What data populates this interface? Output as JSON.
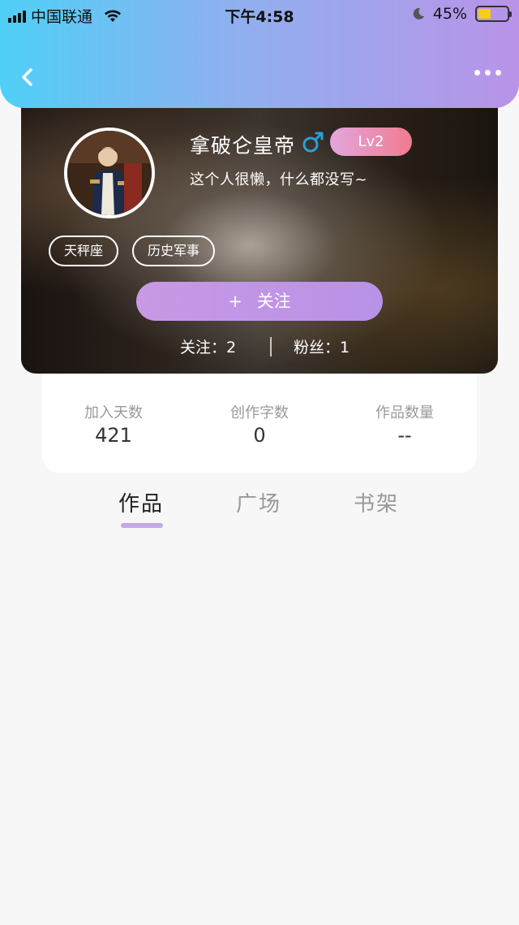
{
  "status_bar": {
    "carrier": "中国联通",
    "time": "下午4:58",
    "battery_percent": "45%",
    "battery_level": 0.45
  },
  "header": {
    "back_icon": "chevron-left-icon",
    "more_icon": "more-horizontal-icon",
    "gradient_colors": [
      "#4fd0f7",
      "#b993e8"
    ]
  },
  "profile": {
    "name": "拿破仑皇帝",
    "gender_icon": "male-icon",
    "level": "Lv2",
    "bio": "这个人很懒，什么都没写~",
    "tags": [
      "天秤座",
      "历史军事"
    ],
    "follow_label": "关注",
    "follow_plus": "+",
    "following_text": "关注：2",
    "fans_text": "粉丝：1"
  },
  "stats": [
    {
      "label": "加入天数",
      "value": "421"
    },
    {
      "label": "创作字数",
      "value": "0"
    },
    {
      "label": "作品数量",
      "value": "--"
    }
  ],
  "tabs": [
    {
      "label": "作品",
      "active": true
    },
    {
      "label": "广场",
      "active": false
    },
    {
      "label": "书架",
      "active": false
    }
  ],
  "colors": {
    "accent": "#c899e4",
    "level_badge": "#f07b8e",
    "gender": "#2a9fd8"
  }
}
